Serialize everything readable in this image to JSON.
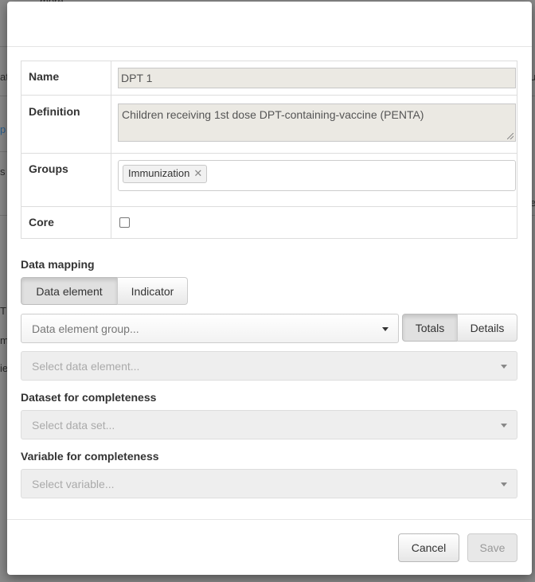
{
  "background": {
    "fragments": [
      "more",
      "at",
      "u",
      "p",
      "s",
      "e",
      "T",
      "m",
      "ie"
    ]
  },
  "form": {
    "name_label": "Name",
    "name_value": "DPT 1",
    "definition_label": "Definition",
    "definition_value": "Children receiving 1st dose DPT-containing-vaccine (PENTA)",
    "groups_label": "Groups",
    "group_tags": [
      "Immunization"
    ],
    "core_label": "Core",
    "core_checked": false
  },
  "data_mapping": {
    "label": "Data mapping",
    "tabs": [
      "Data element",
      "Indicator"
    ],
    "active_tab": "Data element",
    "group_placeholder": "Data element group...",
    "mode_buttons": [
      "Totals",
      "Details"
    ],
    "active_mode": "Totals",
    "element_placeholder": "Select data element..."
  },
  "dataset": {
    "label": "Dataset for completeness",
    "placeholder": "Select data set..."
  },
  "variable": {
    "label": "Variable for completeness",
    "placeholder": "Select variable..."
  },
  "footer": {
    "cancel_label": "Cancel",
    "save_label": "Save"
  },
  "colors": {
    "overlay": "#8a8a8a",
    "readonly_field": "#ebe9e3",
    "active_button": "#e0e0e0"
  }
}
